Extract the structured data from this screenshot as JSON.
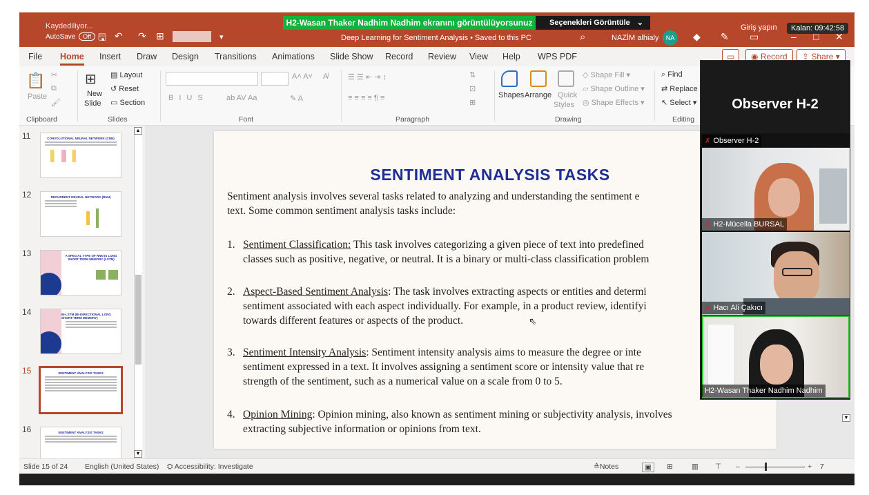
{
  "titlebar": {
    "share_banner": "H2-Wasan Thaker Nadhim Nadhim ekranını görüntülüyorsunuz",
    "view_options": "Seçenekleri Görüntüle",
    "saving_status": "Kaydediliyor...",
    "autosave_label": "AutoSave",
    "autosave_state": "Off",
    "document_title": "Deep Learning for Sentiment Analysis • Saved to this PC",
    "user_name": "NAZİM alhialy",
    "user_initials": "NA",
    "sign_in": "Giriş yapın",
    "remaining_time": "Kalan: 09:42:58"
  },
  "ribbon_tabs": [
    "File",
    "Home",
    "Insert",
    "Draw",
    "Design",
    "Transitions",
    "Animations",
    "Slide Show",
    "Record",
    "Review",
    "View",
    "Help",
    "WPS PDF"
  ],
  "ribbon_buttons": {
    "record": "Record",
    "share": "Share"
  },
  "ribbon": {
    "clipboard": {
      "paste": "Paste",
      "label": "Clipboard"
    },
    "slides": {
      "new_slide": "New",
      "new_slide2": "Slide",
      "layout": "Layout",
      "reset": "Reset",
      "section": "Section",
      "label": "Slides"
    },
    "font": {
      "label": "Font"
    },
    "paragraph": {
      "label": "Paragraph"
    },
    "drawing": {
      "shapes": "Shapes",
      "arrange": "Arrange",
      "quick_styles": "Quick",
      "quick_styles2": "Styles",
      "shape_fill": "Shape Fill",
      "shape_outline": "Shape Outline",
      "shape_effects": "Shape Effects",
      "label": "Drawing"
    },
    "editing": {
      "find": "Find",
      "replace": "Replace",
      "select": "Select",
      "label": "Editing"
    }
  },
  "thumbnails": [
    {
      "num": "11",
      "title": "CONVOLUTIONAL NEURAL NETWORK (CNN)"
    },
    {
      "num": "12",
      "title": "RECURRENT NEURAL NETWORK (RNN)"
    },
    {
      "num": "13",
      "title": "A SPECIAL TYPE OF RNN IS LONG SHORT-TERM MEMORY (LSTM)"
    },
    {
      "num": "14",
      "title": "BI-LSTM (BI-DIRECTIONAL LONG SHORT-TERM MEMORY)"
    },
    {
      "num": "15",
      "title": "SENTIMENT ANALYSIS TASKS"
    },
    {
      "num": "16",
      "title": "SENTIMENT ANALYSIS TASKS"
    }
  ],
  "slide": {
    "title": "SENTIMENT ANALYSIS TASKS",
    "intro_1": "Sentiment analysis involves several tasks related to analyzing and understanding the sentiment e",
    "intro_2": "text. Some common sentiment analysis tasks include:",
    "items": [
      {
        "num": "1.",
        "term": "Sentiment Classification:",
        "line1": " This task involves categorizing a given piece of text into predefined",
        "line2": "classes such as positive, negative, or neutral. It is a binary or multi-class classification problem"
      },
      {
        "num": "2.",
        "term": "Aspect-Based Sentiment Analysis",
        "line1": ": The task involves extracting aspects or entities and determi",
        "line2": "sentiment associated with each aspect individually. For example, in a product review, identifyi",
        "line3": "towards different features or aspects of the product."
      },
      {
        "num": "3.",
        "term": "Sentiment Intensity Analysis",
        "line1": ": Sentiment intensity analysis aims to measure the degree or inte",
        "line2": "sentiment expressed in a text. It involves assigning a sentiment score or intensity value that re",
        "line3": "strength of the sentiment, such as a numerical value on a scale from 0 to 5."
      },
      {
        "num": "4.",
        "term": "Opinion Mining",
        "line1": ": Opinion mining, also known as sentiment mining or subjectivity analysis, involves",
        "line2": "extracting subjective information or opinions from text."
      }
    ]
  },
  "status_bar": {
    "slide_counter": "Slide 15 of 24",
    "language": "English (United States)",
    "accessibility": "Accessibility: Investigate",
    "notes": "Notes",
    "zoom_partial": "7"
  },
  "zoom_panel": {
    "header_name": "Observer H-2",
    "participants": [
      {
        "name": "Observer H-2",
        "muted": true
      },
      {
        "name": "H2-Mücella BURSAL",
        "muted": true
      },
      {
        "name": "Hacı Ali Çakıcı",
        "muted": true
      },
      {
        "name": "H2-Wasan Thaker Nadhim Nadhim",
        "muted": false
      }
    ]
  }
}
